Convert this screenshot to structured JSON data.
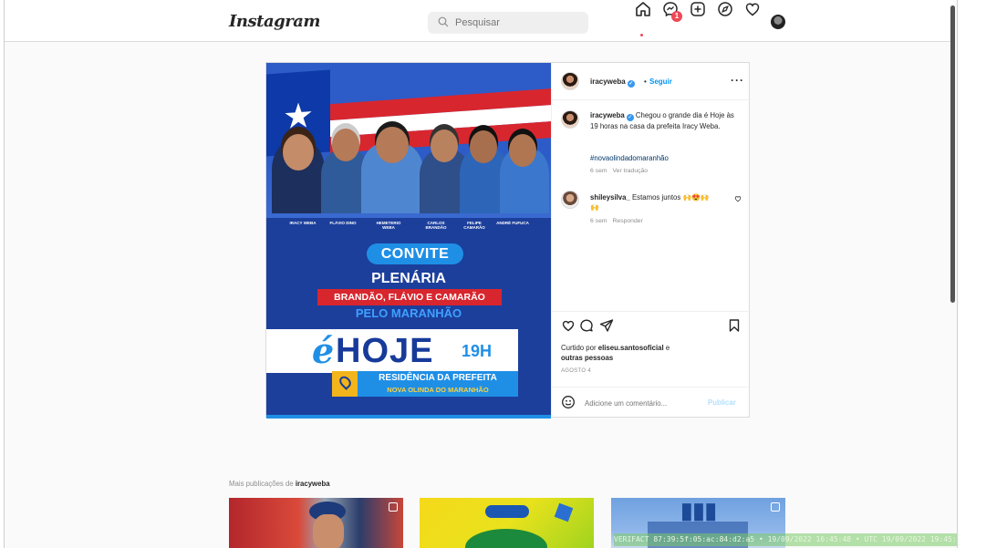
{
  "nav": {
    "logo": "Instagram",
    "search_placeholder": "Pesquisar",
    "notification_count": "1"
  },
  "post": {
    "media": {
      "people": [
        "IRACY WEBA",
        "FLÁVIO DINO",
        "HEMETERIO WEBA",
        "CARLOS BRANDÃO",
        "FELIPE CAMARÃO",
        "ANDRÉ FUFUCA"
      ],
      "convite": "CONVITE",
      "plenaria": "PLENÁRIA",
      "banner": "BRANDÃO, FLÁVIO E CAMARÃO",
      "pelo": "PELO MARANHÃO",
      "hoje_e": "é",
      "hoje": "HOJE",
      "hora": "19H",
      "residencia": "RESIDÊNCIA DA PREFEITA",
      "cidade": "NOVA OLINDA DO MARANHÃO"
    },
    "header": {
      "username": "iracyweba",
      "separator": "•",
      "follow": "Seguir",
      "more": "···"
    },
    "caption": {
      "username": "iracyweba",
      "text": "Chegou o grande dia é Hoje às 19 horas na casa da prefeita Iracy Weba.",
      "hashtag": "#novaolindadomaranhão",
      "time": "6 sem",
      "translate": "Ver tradução"
    },
    "comment": {
      "username": "shileysilva_",
      "text": "Estamos juntos 🙌😍🙌",
      "extra_emoji": "🙌",
      "time": "6 sem",
      "reply": "Responder"
    },
    "likes": {
      "prefix": "Curtido por",
      "user": "eliseu.santosoficial",
      "suffix": "e",
      "others": "outras pessoas"
    },
    "date": "AGOSTO 4",
    "comment_placeholder": "Adicione um comentário...",
    "publish": "Publicar"
  },
  "more_posts": {
    "prefix": "Mais publicações de",
    "username": "iracyweba"
  },
  "watermark": "VERIFACT 87:39:5f:05:ac:84:d2:a5 • 19/09/2022 16:45:48 • UTC 19/09/2022 19:45:48",
  "colors": {
    "accent": "#0095f6",
    "badge": "#ed4956",
    "flyer_blue": "#1c3f9c"
  }
}
